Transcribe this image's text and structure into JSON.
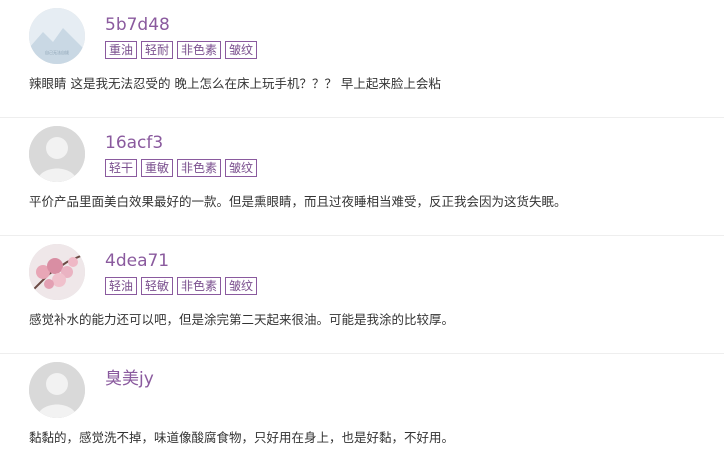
{
  "reviews": [
    {
      "username": "5b7d48",
      "avatar_icon": "default-landscape-avatar-icon",
      "avatar_text": "自己无法自拔",
      "tags": [
        "重油",
        "轻耐",
        "非色素",
        "皱纹"
      ],
      "comment": "辣眼睛 这是我无法忍受的 晚上怎么在床上玩手机？？？ 早上起来脸上会粘"
    },
    {
      "username": "16acf3",
      "avatar_icon": "default-user-avatar-icon",
      "tags": [
        "轻干",
        "重敏",
        "非色素",
        "皱纹"
      ],
      "comment": "平价产品里面美白效果最好的一款。但是熏眼睛，而且过夜睡相当难受，反正我会因为这货失眠。"
    },
    {
      "username": "4dea71",
      "avatar_icon": "cherry-blossom-avatar-icon",
      "tags": [
        "轻油",
        "轻敏",
        "非色素",
        "皱纹"
      ],
      "comment": "感觉补水的能力还可以吧，但是涂完第二天起来很油。可能是我涂的比较厚。"
    },
    {
      "username": "臭美jy",
      "avatar_icon": "default-user-avatar-icon",
      "tags": [],
      "comment": "黏黏的，感觉洗不掉，味道像酸腐食物，只好用在身上，也是好黏，不好用。"
    }
  ],
  "colors": {
    "username": "#8a5a9e",
    "tag_border": "#8a5a9e",
    "divider": "#eeeeee"
  }
}
